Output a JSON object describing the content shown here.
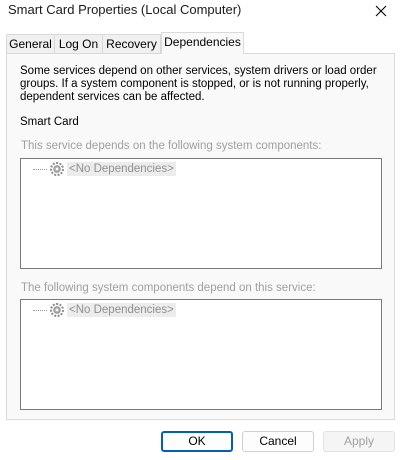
{
  "window": {
    "title": "Smart Card Properties (Local Computer)"
  },
  "tabs": [
    {
      "label": "General"
    },
    {
      "label": "Log On"
    },
    {
      "label": "Recovery"
    },
    {
      "label": "Dependencies",
      "active": true
    }
  ],
  "dependencies": {
    "description": "Some services depend on other services, system drivers or load order groups. If a system component is stopped, or is not running properly, dependent services can be affected.",
    "service_name": "Smart Card",
    "depends_on_label": "This service depends on the following system components:",
    "depends_on_items": [
      "<No Dependencies>"
    ],
    "dependents_label": "The following system components depend on this service:",
    "dependents_items": [
      "<No Dependencies>"
    ]
  },
  "buttons": {
    "ok": "OK",
    "cancel": "Cancel",
    "apply": "Apply"
  },
  "icons": {
    "close": "close-icon",
    "tree_item": "gear-icon"
  }
}
